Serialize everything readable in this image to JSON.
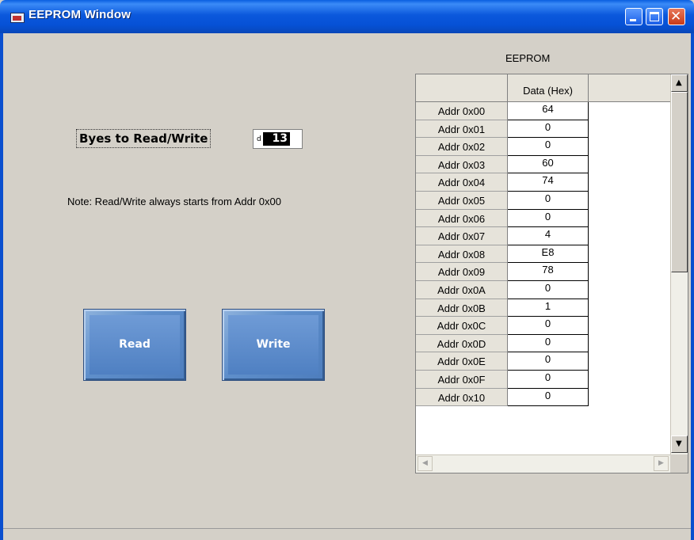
{
  "window": {
    "title": "EEPROM Window",
    "icon": "app-icon",
    "controls": {
      "minimize": "minimize-icon",
      "maximize": "maximize-icon",
      "close": "close-icon"
    }
  },
  "controls": {
    "bytes_label": "Byes to Read/Write",
    "bytes_radix": "d",
    "bytes_value": "13",
    "note": "Note: Read/Write always starts from Addr 0x00",
    "read_label": "Read",
    "write_label": "Write"
  },
  "table": {
    "title": "EEPROM",
    "column_header": "Data (Hex)",
    "rows": [
      {
        "addr": "Addr 0x00",
        "value": "64"
      },
      {
        "addr": "Addr 0x01",
        "value": "0"
      },
      {
        "addr": "Addr 0x02",
        "value": "0"
      },
      {
        "addr": "Addr 0x03",
        "value": "60"
      },
      {
        "addr": "Addr 0x04",
        "value": "74"
      },
      {
        "addr": "Addr 0x05",
        "value": "0"
      },
      {
        "addr": "Addr 0x06",
        "value": "0"
      },
      {
        "addr": "Addr 0x07",
        "value": "4"
      },
      {
        "addr": "Addr 0x08",
        "value": "E8"
      },
      {
        "addr": "Addr 0x09",
        "value": "78"
      },
      {
        "addr": "Addr 0x0A",
        "value": "0"
      },
      {
        "addr": "Addr 0x0B",
        "value": "1"
      },
      {
        "addr": "Addr 0x0C",
        "value": "0"
      },
      {
        "addr": "Addr 0x0D",
        "value": "0"
      },
      {
        "addr": "Addr 0x0E",
        "value": "0"
      },
      {
        "addr": "Addr 0x0F",
        "value": "0"
      },
      {
        "addr": "Addr 0x10",
        "value": "0"
      }
    ]
  },
  "colors": {
    "titlebar": "#0651d6",
    "button": "#5f8fcb",
    "background": "#d4d0c8"
  }
}
